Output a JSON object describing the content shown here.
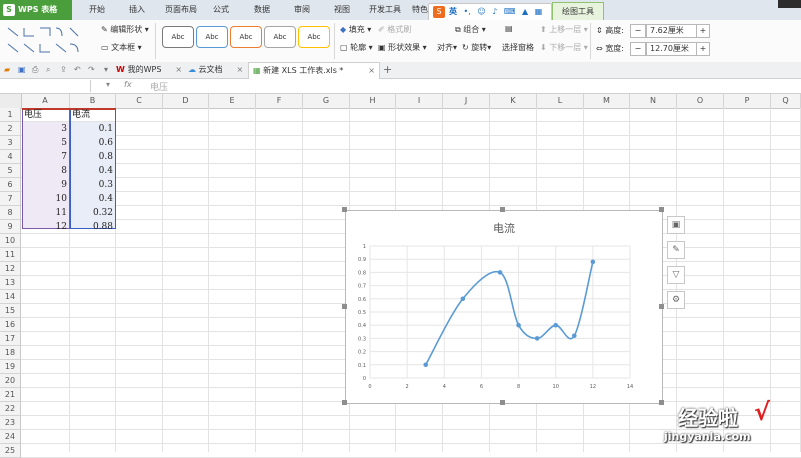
{
  "app": {
    "title": "WPS 表格"
  },
  "menu": [
    "开始",
    "插入",
    "页面布局",
    "公式",
    "数据",
    "审阅",
    "视图",
    "开发工具",
    "特色"
  ],
  "ime": {
    "label": "英"
  },
  "context_tab": "绘图工具",
  "ribbon": {
    "edit_shape": "编辑形状",
    "textbox": "文本框",
    "style_sample": "Abc",
    "fill": "填充",
    "format_painter": "格式刷",
    "outline": "轮廓",
    "shape_effect": "形状效果",
    "group": "组合",
    "bring_forward": "上移一层",
    "send_backward": "下移一层",
    "align": "对齐",
    "rotate": "旋转",
    "selection_pane": "选择窗格",
    "height_label": "高度:",
    "height_value": "7.62厘米",
    "width_label": "宽度:",
    "width_value": "12.70厘米"
  },
  "tabs": [
    {
      "label": "我的WPS"
    },
    {
      "label": "云文档"
    },
    {
      "label": "新建 XLS 工作表.xls *"
    }
  ],
  "formula": {
    "fx": "fx",
    "content": "电压"
  },
  "columns": [
    "A",
    "B",
    "C",
    "D",
    "E",
    "F",
    "G",
    "H",
    "I",
    "J",
    "K",
    "L",
    "M",
    "N",
    "O",
    "P",
    "Q"
  ],
  "rows": [
    "1",
    "2",
    "3",
    "4",
    "5",
    "6",
    "7",
    "8",
    "9",
    "10",
    "11",
    "12",
    "13",
    "14",
    "15",
    "16",
    "17",
    "18",
    "19",
    "20",
    "21",
    "22",
    "23",
    "24",
    "25"
  ],
  "table": {
    "headers": [
      "电压",
      "电流"
    ],
    "a": [
      "3",
      "5",
      "7",
      "8",
      "9",
      "10",
      "11",
      "12"
    ],
    "b": [
      "0.1",
      "0.6",
      "0.8",
      "0.4",
      "0.3",
      "0.4",
      "0.32",
      "0.88"
    ]
  },
  "chart_data": {
    "type": "scatter",
    "title": "电流",
    "x": [
      3,
      5,
      7,
      8,
      9,
      10,
      11,
      12
    ],
    "y": [
      0.1,
      0.6,
      0.8,
      0.4,
      0.3,
      0.4,
      0.32,
      0.88
    ],
    "smooth": true,
    "xlim": [
      0,
      14
    ],
    "ylim": [
      0,
      1
    ],
    "xticks": [
      "0",
      "2",
      "4",
      "6",
      "8",
      "10",
      "12",
      "14"
    ],
    "yticks": [
      "0",
      "0.1",
      "0.2",
      "0.3",
      "0.4",
      "0.5",
      "0.6",
      "0.7",
      "0.8",
      "0.9",
      "1"
    ],
    "grid": true,
    "color": "#5b9bd5"
  },
  "watermark": {
    "text": "经验啦",
    "check": "√",
    "url": "jingyanla.com"
  },
  "colors": {
    "brand": "#4a9e3c",
    "series": "#5b9bd5",
    "ime": "#ee6d1d"
  }
}
